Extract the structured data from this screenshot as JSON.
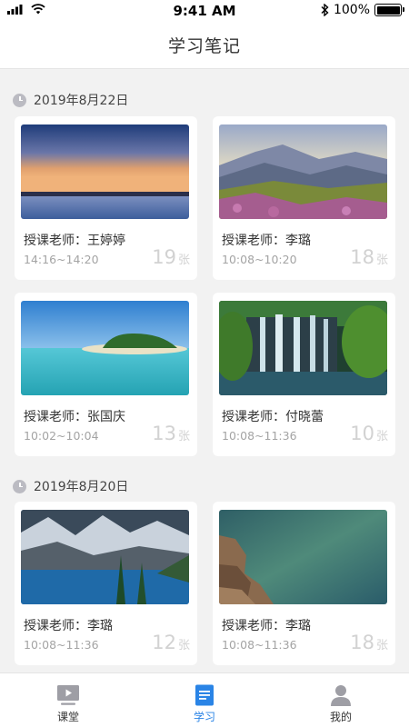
{
  "status_bar": {
    "time": "9:41 AM",
    "battery": "100%"
  },
  "header": {
    "title": "学习笔记"
  },
  "groups": [
    {
      "date": "2019年8月22日",
      "cards": [
        {
          "teacher": "授课老师：王婷婷",
          "time": "14:16~14:20",
          "count": "19",
          "unit": "张",
          "image": "sunset-sea-image"
        },
        {
          "teacher": "授课老师：李璐",
          "time": "10:08~10:20",
          "count": "18",
          "unit": "张",
          "image": "mountain-flowers-image"
        },
        {
          "teacher": "授课老师：张国庆",
          "time": "10:02~10:04",
          "count": "13",
          "unit": "张",
          "image": "tropical-island-image"
        },
        {
          "teacher": "授课老师：付晓蕾",
          "time": "10:08~11:36",
          "count": "10",
          "unit": "张",
          "image": "waterfall-image"
        }
      ]
    },
    {
      "date": "2019年8月20日",
      "cards": [
        {
          "teacher": "授课老师：李璐",
          "time": "10:08~11:36",
          "count": "12",
          "unit": "张",
          "image": "mountain-lake-image"
        },
        {
          "teacher": "授课老师：李璐",
          "time": "10:08~11:36",
          "count": "18",
          "unit": "张",
          "image": "rocky-lake-image"
        }
      ]
    }
  ],
  "tabs": [
    {
      "label": "课堂",
      "icon": "video-icon",
      "active": false
    },
    {
      "label": "学习",
      "icon": "notebook-icon",
      "active": true
    },
    {
      "label": "我的",
      "icon": "person-icon",
      "active": false
    }
  ],
  "colors": {
    "accent": "#2a84e6",
    "inactive_icon": "#9e9ea5",
    "background": "#f2f2f2"
  }
}
